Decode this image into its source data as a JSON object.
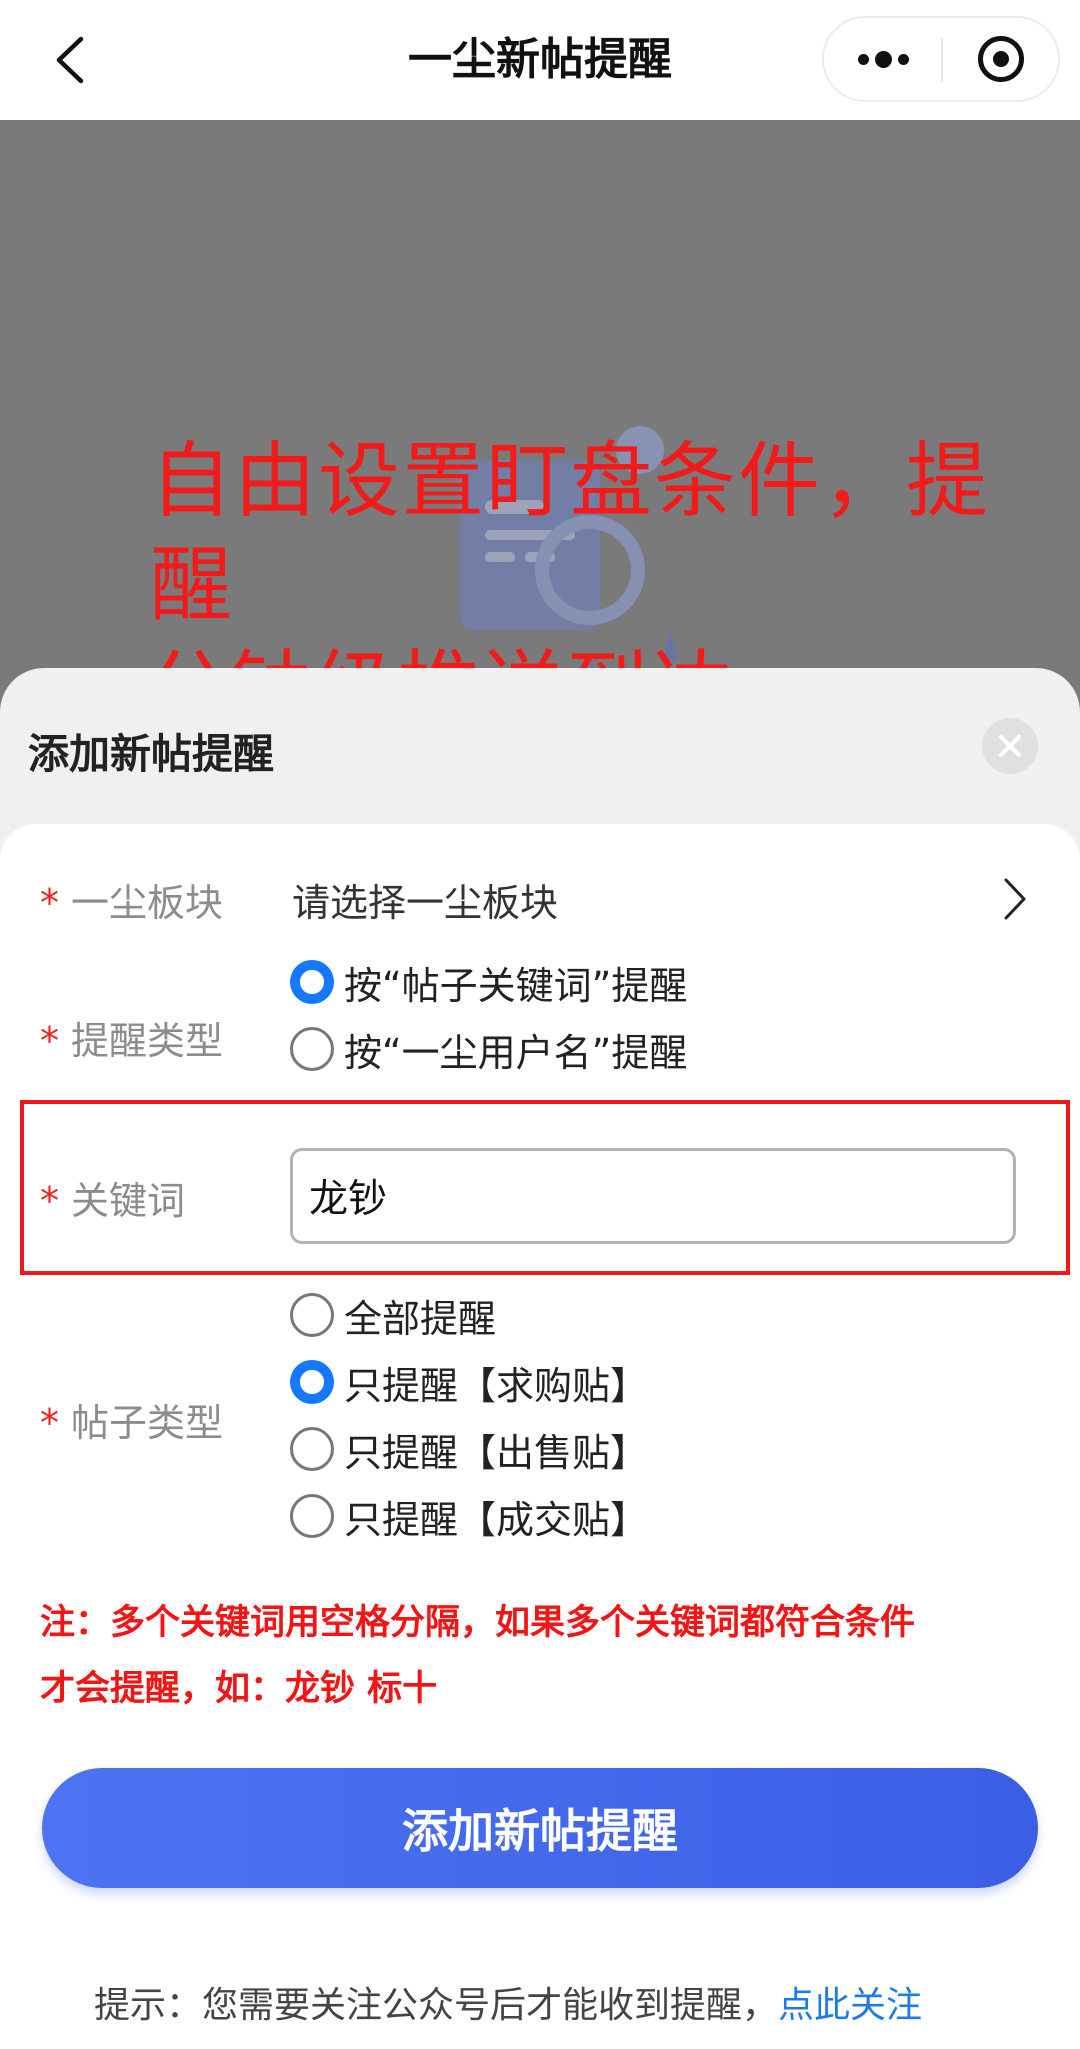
{
  "nav": {
    "title": "一尘新帖提醒"
  },
  "promo": {
    "line1": "自由设置盯盘条件，提醒",
    "line2": "分钟级推送到达"
  },
  "sheet": {
    "title": "添加新帖提醒"
  },
  "form": {
    "required_mark": "*",
    "board": {
      "label": "一尘板块",
      "placeholder": "请选择一尘板块"
    },
    "remind_type": {
      "label": "提醒类型",
      "options": [
        {
          "label": "按“帖子关键词”提醒",
          "checked": true
        },
        {
          "label": "按“一尘用户名”提醒",
          "checked": false
        }
      ]
    },
    "keyword": {
      "label": "关键词",
      "value": "龙钞"
    },
    "post_type": {
      "label": "帖子类型",
      "options": [
        {
          "label": "全部提醒",
          "checked": false
        },
        {
          "label": "只提醒【求购贴】",
          "checked": true
        },
        {
          "label": "只提醒【出售贴】",
          "checked": false
        },
        {
          "label": "只提醒【成交贴】",
          "checked": false
        }
      ]
    },
    "note_line1": "注：多个关键词用空格分隔，如果多个关键词都符合条件",
    "note_line2": "才会提醒，如：龙钞 标十",
    "submit_label": "添加新帖提醒"
  },
  "tip": {
    "text": "提示：您需要关注公众号后才能收到提醒，",
    "link": "点此关注"
  },
  "colors": {
    "accent": "#1677ff",
    "primary_button": "#4468ee",
    "required": "#f02020",
    "highlight_border": "#f01818",
    "link": "#1e7be5",
    "overlay": "#7a7a7a"
  }
}
